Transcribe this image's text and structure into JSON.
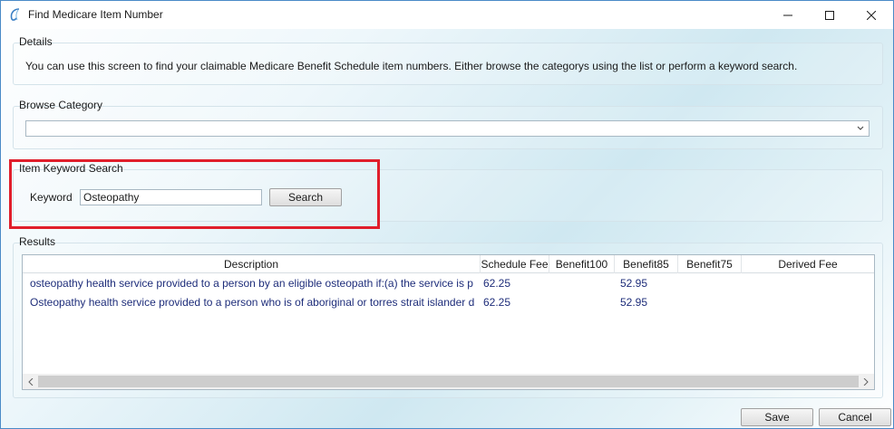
{
  "window": {
    "title": "Find Medicare Item Number"
  },
  "details": {
    "label": "Details",
    "text": "You can use this screen to find your claimable Medicare Benefit Schedule item numbers. Either browse the categorys using the list or perform a keyword search."
  },
  "browse": {
    "label": "Browse Category",
    "value": ""
  },
  "keyword_search": {
    "label": "Item Keyword Search",
    "keyword_label": "Keyword",
    "keyword_value": "Osteopathy",
    "search_button": "Search"
  },
  "results": {
    "label": "Results",
    "columns": [
      "Description",
      "Schedule Fee",
      "Benefit100",
      "Benefit85",
      "Benefit75",
      "Derived Fee"
    ],
    "rows": [
      {
        "description": "osteopathy health service provided to a person by an eligible osteopath if:(a) the service is p",
        "schedule_fee": "62.25",
        "benefit100": "",
        "benefit85": "52.95",
        "benefit75": "",
        "derived_fee": ""
      },
      {
        "description": "Osteopathy health service provided to a person who is of aboriginal or torres strait islander d",
        "schedule_fee": "62.25",
        "benefit100": "",
        "benefit85": "52.95",
        "benefit75": "",
        "derived_fee": ""
      }
    ]
  },
  "footer": {
    "save_button": "Save",
    "cancel_button": "Cancel"
  },
  "colors": {
    "highlight": "#e01e2b",
    "row_text": "#1e2d7a",
    "window_border": "#4a8ac7"
  }
}
